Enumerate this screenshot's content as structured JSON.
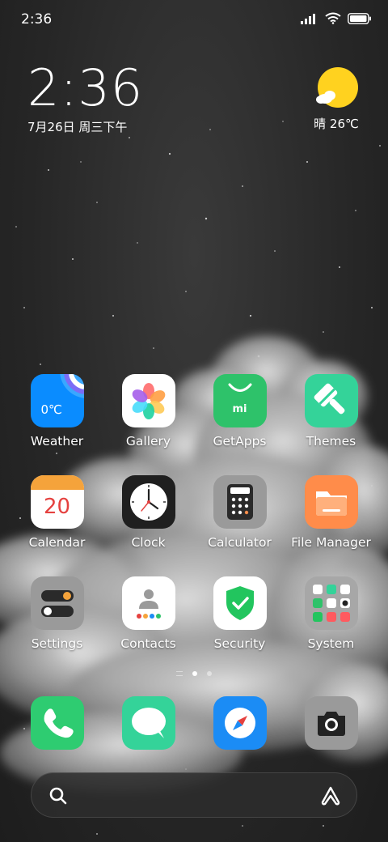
{
  "status_bar": {
    "time": "2:36"
  },
  "clock_widget": {
    "time": "2:36",
    "date": "7月26日 周三下午"
  },
  "weather_widget": {
    "condition_temp": "晴 26℃",
    "icon": "sun-cloud-icon"
  },
  "apps": [
    {
      "label": "Weather",
      "icon": "weather-icon",
      "temp": "0℃"
    },
    {
      "label": "Gallery",
      "icon": "gallery-icon"
    },
    {
      "label": "GetApps",
      "icon": "getapps-icon",
      "brand": "mi"
    },
    {
      "label": "Themes",
      "icon": "themes-brush-icon"
    },
    {
      "label": "Calendar",
      "icon": "calendar-icon",
      "day": "20"
    },
    {
      "label": "Clock",
      "icon": "clock-icon"
    },
    {
      "label": "Calculator",
      "icon": "calculator-icon"
    },
    {
      "label": "File Manager",
      "icon": "folder-icon"
    },
    {
      "label": "Settings",
      "icon": "settings-toggle-icon"
    },
    {
      "label": "Contacts",
      "icon": "contacts-icon"
    },
    {
      "label": "Security",
      "icon": "security-shield-icon"
    },
    {
      "label": "System",
      "icon": "system-folder-icon"
    }
  ],
  "page_indicator": {
    "pages": 2,
    "current": 1
  },
  "dock": [
    {
      "icon": "phone-icon"
    },
    {
      "icon": "messages-icon"
    },
    {
      "icon": "browser-compass-icon"
    },
    {
      "icon": "camera-icon"
    }
  ],
  "search_bar": {
    "search_icon": "search-icon",
    "assistant_icon": "assistant-icon"
  },
  "colors": {
    "weather": "#0a8cff",
    "getapps": "#2ec26a",
    "themes": "#34d399",
    "calendar_top": "#f5a33b",
    "calendar_day": "#e5413f",
    "filemanager": "#ff8c4a",
    "security": "#22c55e",
    "phone": "#2ecc71",
    "messages": "#34d399",
    "browser": "#1b8cf5"
  }
}
